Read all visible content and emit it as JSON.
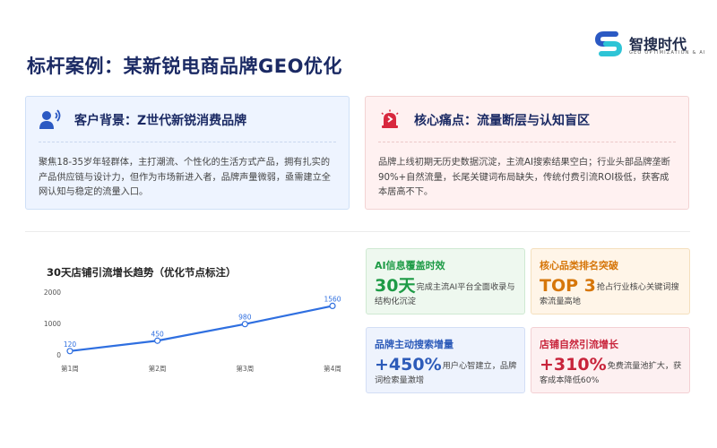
{
  "page": {
    "title": "标杆案例：某新锐电商品牌GEO优化"
  },
  "logo": {
    "name": "智搜时代",
    "tagline": "GEO OPTIMIZATION & AI"
  },
  "cards": [
    {
      "id": "customer",
      "icon": "user-speaking-icon",
      "title": "客户背景：Z世代新锐消费品牌",
      "body": "聚焦18-35岁年轻群体，主打潮流、个性化的生活方式产品，拥有扎实的产品供应链与设计力，但作为市场新进入者，品牌声量微弱，亟需建立全网认知与稳定的流量入口。"
    },
    {
      "id": "pain",
      "icon": "alarm-icon",
      "title": "核心痛点：流量断层与认知盲区",
      "body": "品牌上线初期无历史数据沉淀，主流AI搜索结果空白；行业头部品牌垄断90%+自然流量，长尾关键词布局缺失，传统付费引流ROI极低，获客成本居高不下。"
    }
  ],
  "chart_data": {
    "type": "line",
    "title": "30天店铺引流增长趋势（优化节点标注）",
    "categories": [
      "第1周",
      "第2周",
      "第3周",
      "第4周"
    ],
    "values": [
      120,
      450,
      980,
      1560
    ],
    "data_labels": [
      "120",
      "450",
      "980",
      "1560"
    ],
    "yticks": [
      "0",
      "1000",
      "2000"
    ],
    "ylim": [
      0,
      2000
    ],
    "color": "#2f6fe0"
  },
  "stats": [
    {
      "id": "ai-coverage",
      "label": "AI信息覆盖时效",
      "big": "30天",
      "rest": "完成主流AI平台全面收录与结构化沉淀"
    },
    {
      "id": "category-rank",
      "label": "核心品类排名突破",
      "big": "TOP 3",
      "rest": "抢占行业核心关键词搜索流量高地"
    },
    {
      "id": "brand-search",
      "label": "品牌主动搜索增量",
      "big": "+450%",
      "rest": "用户心智建立，品牌词检索量激增"
    },
    {
      "id": "organic-traffic",
      "label": "店铺自然引流增长",
      "big": "+310%",
      "rest": "免费流量池扩大，获客成本降低60%"
    }
  ]
}
